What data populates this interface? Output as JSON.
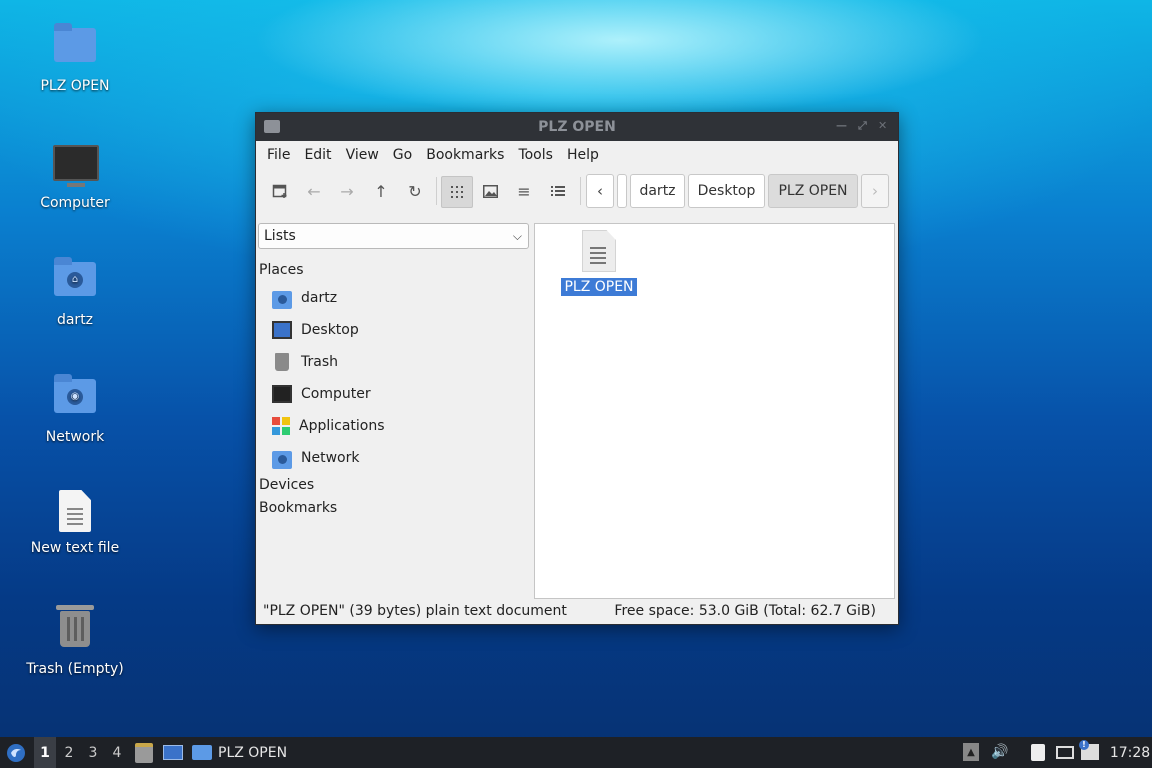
{
  "desktop": {
    "icons": [
      {
        "label": "PLZ OPEN",
        "icon": "folder-icon"
      },
      {
        "label": "Computer",
        "icon": "computer-icon"
      },
      {
        "label": "dartz",
        "icon": "home-folder-icon"
      },
      {
        "label": "Network",
        "icon": "network-folder-icon"
      },
      {
        "label": "New text file",
        "icon": "text-file-icon"
      },
      {
        "label": "Trash (Empty)",
        "icon": "trash-icon"
      }
    ]
  },
  "window": {
    "title": "PLZ OPEN",
    "menu": [
      "File",
      "Edit",
      "View",
      "Go",
      "Bookmarks",
      "Tools",
      "Help"
    ],
    "breadcrumbs": [
      "dartz",
      "Desktop",
      "PLZ OPEN"
    ],
    "sidebar": {
      "mode": "Lists",
      "places_header": "Places",
      "places": [
        {
          "label": "dartz",
          "icon": "home-folder-icon"
        },
        {
          "label": "Desktop",
          "icon": "desktop-icon"
        },
        {
          "label": "Trash",
          "icon": "trash-icon"
        },
        {
          "label": "Computer",
          "icon": "computer-icon"
        },
        {
          "label": "Applications",
          "icon": "applications-icon"
        },
        {
          "label": "Network",
          "icon": "network-icon"
        }
      ],
      "devices_header": "Devices",
      "bookmarks_header": "Bookmarks"
    },
    "files": [
      {
        "name": "PLZ OPEN",
        "icon": "text-file-icon",
        "selected": true
      }
    ],
    "status": {
      "left": "\"PLZ OPEN\" (39 bytes) plain text document",
      "right": "Free space: 53.0 GiB (Total: 62.7 GiB)"
    }
  },
  "taskbar": {
    "workspaces": [
      "1",
      "2",
      "3",
      "4"
    ],
    "active_workspace": "1",
    "task_label": "PLZ OPEN",
    "clock": "17:28"
  },
  "colors": {
    "selection": "#3d7bd6",
    "titlebar": "#2f3237",
    "taskbar": "#1e2126",
    "folder": "#5c9ae6"
  }
}
